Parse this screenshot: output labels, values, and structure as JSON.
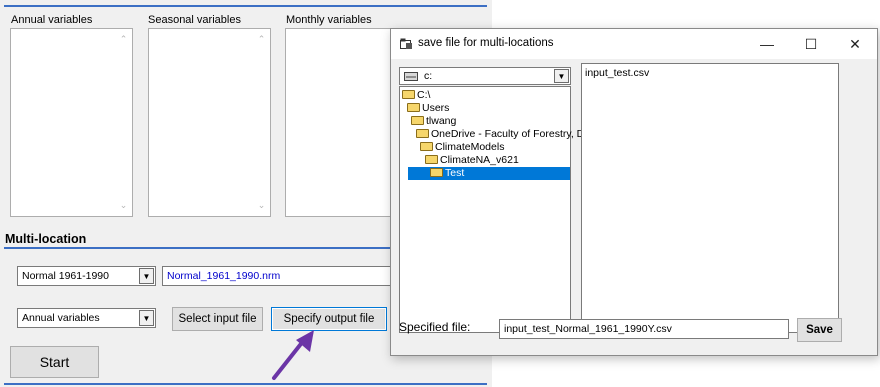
{
  "main": {
    "annual_label": "Annual variables",
    "seasonal_label": "Seasonal variables",
    "monthly_label": "Monthly variables",
    "section_title": "Multi-location",
    "normal_period": "Normal 1961-1990",
    "nrm_file": "Normal_1961_1990.nrm",
    "variable_type": "Annual variables",
    "select_input_label": "Select input file",
    "specify_output_label": "Specify output file",
    "start_label": "Start"
  },
  "dialog": {
    "title": "save file for multi-locations",
    "minimize": "—",
    "maximize": "☐",
    "close": "✕",
    "drive": "c:",
    "folders": [
      "C:\\",
      "Users",
      "tlwang",
      "OneDrive - Faculty of Forestry, De",
      "ClimateModels",
      "ClimateNA_v621",
      "Test"
    ],
    "files": [
      "input_test.csv"
    ],
    "specified_label": "Specified file:",
    "specified_value": "input_test_Normal_1961_1990Y.csv",
    "save_label": "Save"
  },
  "colors": {
    "accent": "#3c6fc4",
    "selection": "#0078d7",
    "arrow": "#6b35a6",
    "link_text": "#0000cc"
  }
}
